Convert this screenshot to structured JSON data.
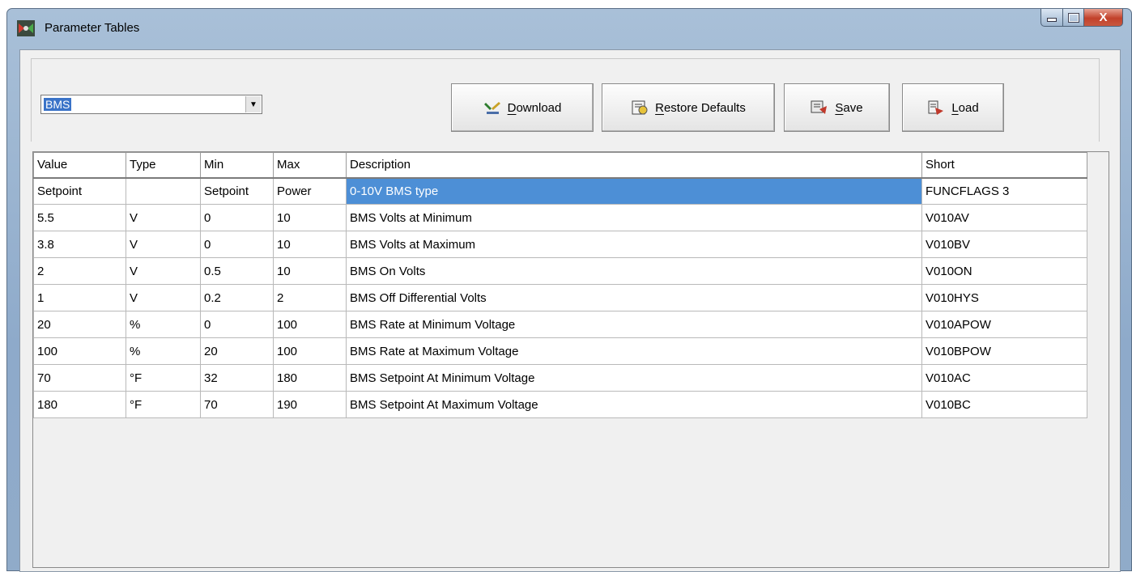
{
  "window": {
    "title": "Parameter Tables",
    "controls": {
      "minimize": "",
      "maximize": "",
      "close": "X"
    }
  },
  "toolbar": {
    "table_select": {
      "value": "BMS"
    },
    "buttons": [
      {
        "mnemonic": "D",
        "rest": "ownload",
        "icon": "download-icon"
      },
      {
        "mnemonic": "R",
        "rest": "estore Defaults",
        "icon": "restore-icon"
      },
      {
        "mnemonic": "S",
        "rest": "ave",
        "icon": "save-icon"
      },
      {
        "mnemonic": "L",
        "rest": "oad",
        "icon": "load-icon"
      }
    ]
  },
  "grid": {
    "columns": [
      "Value",
      "Type",
      "Min",
      "Max",
      "Description",
      "Short"
    ],
    "rows": [
      [
        "Setpoint",
        "",
        "Setpoint",
        "Power",
        "0-10V BMS type",
        "FUNCFLAGS 3"
      ],
      [
        "5.5",
        "V",
        "0",
        "10",
        "BMS Volts at Minimum",
        "V010AV"
      ],
      [
        "3.8",
        "V",
        "0",
        "10",
        "BMS Volts at Maximum",
        "V010BV"
      ],
      [
        "2",
        "V",
        "0.5",
        "10",
        "BMS On Volts",
        "V010ON"
      ],
      [
        "1",
        "V",
        "0.2",
        "2",
        "BMS Off Differential Volts",
        "V010HYS"
      ],
      [
        "20",
        "%",
        "0",
        "100",
        "BMS Rate at Minimum Voltage",
        "V010APOW"
      ],
      [
        "100",
        "%",
        "20",
        "100",
        "BMS Rate at Maximum Voltage",
        "V010BPOW"
      ],
      [
        "70",
        "°F",
        "32",
        "180",
        "BMS Setpoint At Minimum Voltage",
        "V010AC"
      ],
      [
        "180",
        "°F",
        "70",
        "190",
        "BMS Setpoint At Maximum Voltage",
        "V010BC"
      ]
    ]
  },
  "colors": {
    "selection": "#4d8fd6",
    "close_button": "#c2412b"
  }
}
